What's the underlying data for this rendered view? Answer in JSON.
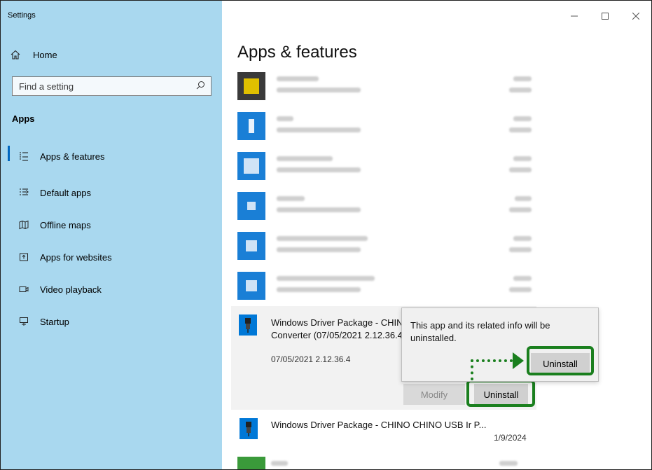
{
  "window": {
    "title": "Settings"
  },
  "sidebar": {
    "home_label": "Home",
    "search_placeholder": "Find a setting",
    "section_label": "Apps",
    "items": [
      {
        "label": "Apps & features",
        "icon": "apps-features-icon",
        "active": true
      },
      {
        "label": "Default apps",
        "icon": "default-apps-icon"
      },
      {
        "label": "Offline maps",
        "icon": "map-icon"
      },
      {
        "label": "Apps for websites",
        "icon": "website-icon"
      },
      {
        "label": "Video playback",
        "icon": "video-icon"
      },
      {
        "label": "Startup",
        "icon": "startup-icon"
      }
    ]
  },
  "main": {
    "page_title": "Apps & features",
    "expanded_app": {
      "title_line1": "Windows Driver Package - CHINO CHINO USB Ir",
      "title_line2": "Converter (07/05/2021 2.12.36.4)",
      "version": "07/05/2021 2.12.36.4",
      "modify_label": "Modify",
      "uninstall_label": "Uninstall"
    },
    "popup": {
      "message": "This app and its related info will be uninstalled.",
      "uninstall_label": "Uninstall"
    },
    "next_app": {
      "title": "Windows Driver Package - CHINO CHINO USB Ir P...",
      "date": "1/9/2024"
    }
  },
  "colors": {
    "sidebar_bg": "#a9d8ef",
    "accent": "#0078d7",
    "highlight": "#1a7f1e"
  }
}
